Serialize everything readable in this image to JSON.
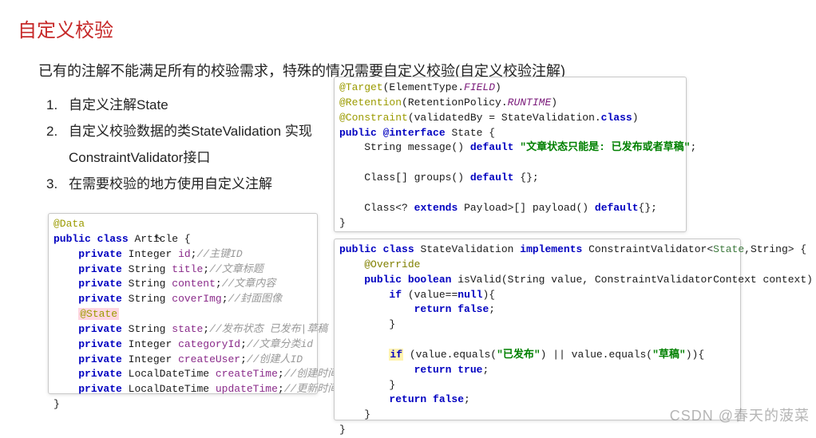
{
  "title": "自定义校验",
  "subtitle": "已有的注解不能满足所有的校验需求，特殊的情况需要自定义校验(自定义校验注解)",
  "steps": [
    "自定义注解State",
    "自定义校验数据的类StateValidation 实现ConstraintValidator接口",
    "在需要校验的地方使用自定义注解"
  ],
  "article_code": {
    "anno_data": "@Data",
    "decl": {
      "public": "public",
      "class": "class",
      "name": "Article",
      "brace": " {"
    },
    "fields": [
      {
        "mod": "private",
        "type": "Integer",
        "name": "id",
        "comment": "//主键ID"
      },
      {
        "mod": "private",
        "type": "String",
        "name": "title",
        "comment": "//文章标题"
      },
      {
        "mod": "private",
        "type": "String",
        "name": "content",
        "comment": "//文章内容"
      },
      {
        "mod": "private",
        "type": "String",
        "name": "coverImg",
        "comment": "//封面图像"
      }
    ],
    "state_anno": "@State",
    "fields2": [
      {
        "mod": "private",
        "type": "String",
        "name": "state",
        "comment": "//发布状态 已发布|草稿"
      },
      {
        "mod": "private",
        "type": "Integer",
        "name": "categoryId",
        "comment": "//文章分类id"
      },
      {
        "mod": "private",
        "type": "Integer",
        "name": "createUser",
        "comment": "//创建人ID"
      },
      {
        "mod": "private",
        "type": "LocalDateTime",
        "name": "createTime",
        "comment": "//创建时间"
      },
      {
        "mod": "private",
        "type": "LocalDateTime",
        "name": "updateTime",
        "comment": "//更新时间"
      }
    ],
    "close": "}"
  },
  "state_code": {
    "l1": {
      "a": "@Target",
      "b": "(ElementType.",
      "c": "FIELD",
      "d": ")"
    },
    "l2": {
      "a": "@Retention",
      "b": "(RetentionPolicy.",
      "c": "RUNTIME",
      "d": ")"
    },
    "l3": {
      "a": "@Constraint",
      "b": "(validatedBy = StateValidation.",
      "c": "class",
      "d": ")"
    },
    "l4": {
      "a": "public",
      "b": "@interface",
      "c": "State {"
    },
    "l5": {
      "a": "String message()",
      "b": "default",
      "c": "\"文章状态只能是: 已发布或者草稿\"",
      "d": ";"
    },
    "l6": {
      "a": "Class[] groups()",
      "b": "default",
      "c": "{};"
    },
    "l7": {
      "a": "Class<?",
      "b": "extends",
      "c": "Payload>[] payload()",
      "d": "default",
      "e": "{};"
    },
    "l8": "}"
  },
  "validation_code": {
    "l1": {
      "a": "public class",
      "b": "StateValidation",
      "c": "implements",
      "d": "ConstraintValidator<",
      "e": "State",
      "f": ",String> {"
    },
    "l2": "@Override",
    "l3": {
      "a": "public boolean",
      "b": "isValid(String value, ConstraintValidatorContext context) {"
    },
    "l4": {
      "a": "if",
      "b": "(value==",
      "c": "null",
      "d": "){"
    },
    "l5": {
      "a": "return false",
      "b": ";"
    },
    "l6": "}",
    "l7": {
      "a": "if",
      "b": "(value.equals(",
      "c": "\"已发布\"",
      "d": ") || value.equals(",
      "e": "\"草稿\"",
      "f": ")){"
    },
    "l8": {
      "a": "return true",
      "b": ";"
    },
    "l9": "}",
    "l10": {
      "a": "return false",
      "b": ";"
    },
    "l11": "}",
    "l12": "}"
  },
  "watermark": "CSDN @春天的菠菜"
}
